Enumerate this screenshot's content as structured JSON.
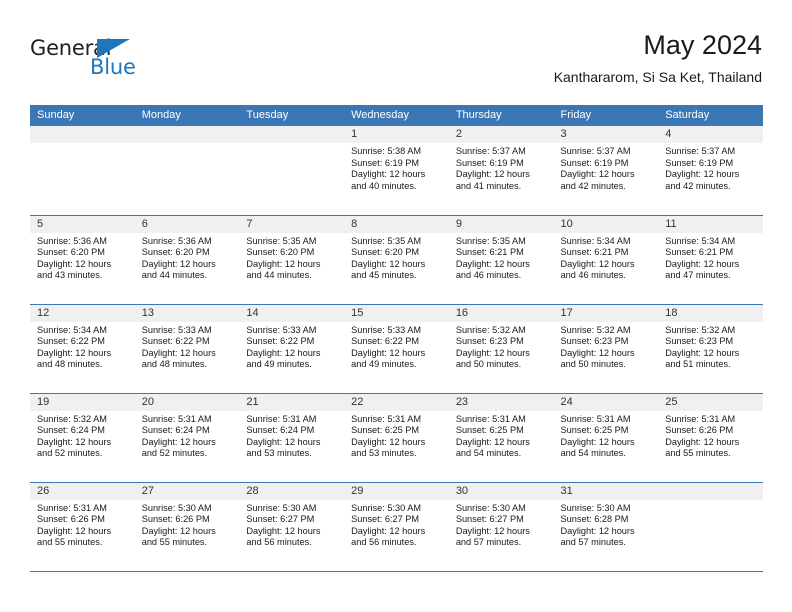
{
  "brand": {
    "name_primary": "General",
    "name_secondary": "Blue"
  },
  "header": {
    "title": "May 2024",
    "subtitle": "Kanthararom, Si Sa Ket, Thailand"
  },
  "colors": {
    "header_blue": "#3b77b5",
    "brand_blue": "#1f76bc",
    "daynum_band": "#f0f0f0"
  },
  "calendar": {
    "day_names": [
      "Sunday",
      "Monday",
      "Tuesday",
      "Wednesday",
      "Thursday",
      "Friday",
      "Saturday"
    ],
    "weeks": [
      [
        {
          "day": "",
          "empty": true
        },
        {
          "day": "",
          "empty": true
        },
        {
          "day": "",
          "empty": true
        },
        {
          "day": "1",
          "sunrise": "Sunrise: 5:38 AM",
          "sunset": "Sunset: 6:19 PM",
          "daylight_1": "Daylight: 12 hours",
          "daylight_2": "and 40 minutes."
        },
        {
          "day": "2",
          "sunrise": "Sunrise: 5:37 AM",
          "sunset": "Sunset: 6:19 PM",
          "daylight_1": "Daylight: 12 hours",
          "daylight_2": "and 41 minutes."
        },
        {
          "day": "3",
          "sunrise": "Sunrise: 5:37 AM",
          "sunset": "Sunset: 6:19 PM",
          "daylight_1": "Daylight: 12 hours",
          "daylight_2": "and 42 minutes."
        },
        {
          "day": "4",
          "sunrise": "Sunrise: 5:37 AM",
          "sunset": "Sunset: 6:19 PM",
          "daylight_1": "Daylight: 12 hours",
          "daylight_2": "and 42 minutes."
        }
      ],
      [
        {
          "day": "5",
          "sunrise": "Sunrise: 5:36 AM",
          "sunset": "Sunset: 6:20 PM",
          "daylight_1": "Daylight: 12 hours",
          "daylight_2": "and 43 minutes."
        },
        {
          "day": "6",
          "sunrise": "Sunrise: 5:36 AM",
          "sunset": "Sunset: 6:20 PM",
          "daylight_1": "Daylight: 12 hours",
          "daylight_2": "and 44 minutes."
        },
        {
          "day": "7",
          "sunrise": "Sunrise: 5:35 AM",
          "sunset": "Sunset: 6:20 PM",
          "daylight_1": "Daylight: 12 hours",
          "daylight_2": "and 44 minutes."
        },
        {
          "day": "8",
          "sunrise": "Sunrise: 5:35 AM",
          "sunset": "Sunset: 6:20 PM",
          "daylight_1": "Daylight: 12 hours",
          "daylight_2": "and 45 minutes."
        },
        {
          "day": "9",
          "sunrise": "Sunrise: 5:35 AM",
          "sunset": "Sunset: 6:21 PM",
          "daylight_1": "Daylight: 12 hours",
          "daylight_2": "and 46 minutes."
        },
        {
          "day": "10",
          "sunrise": "Sunrise: 5:34 AM",
          "sunset": "Sunset: 6:21 PM",
          "daylight_1": "Daylight: 12 hours",
          "daylight_2": "and 46 minutes."
        },
        {
          "day": "11",
          "sunrise": "Sunrise: 5:34 AM",
          "sunset": "Sunset: 6:21 PM",
          "daylight_1": "Daylight: 12 hours",
          "daylight_2": "and 47 minutes."
        }
      ],
      [
        {
          "day": "12",
          "sunrise": "Sunrise: 5:34 AM",
          "sunset": "Sunset: 6:22 PM",
          "daylight_1": "Daylight: 12 hours",
          "daylight_2": "and 48 minutes."
        },
        {
          "day": "13",
          "sunrise": "Sunrise: 5:33 AM",
          "sunset": "Sunset: 6:22 PM",
          "daylight_1": "Daylight: 12 hours",
          "daylight_2": "and 48 minutes."
        },
        {
          "day": "14",
          "sunrise": "Sunrise: 5:33 AM",
          "sunset": "Sunset: 6:22 PM",
          "daylight_1": "Daylight: 12 hours",
          "daylight_2": "and 49 minutes."
        },
        {
          "day": "15",
          "sunrise": "Sunrise: 5:33 AM",
          "sunset": "Sunset: 6:22 PM",
          "daylight_1": "Daylight: 12 hours",
          "daylight_2": "and 49 minutes."
        },
        {
          "day": "16",
          "sunrise": "Sunrise: 5:32 AM",
          "sunset": "Sunset: 6:23 PM",
          "daylight_1": "Daylight: 12 hours",
          "daylight_2": "and 50 minutes."
        },
        {
          "day": "17",
          "sunrise": "Sunrise: 5:32 AM",
          "sunset": "Sunset: 6:23 PM",
          "daylight_1": "Daylight: 12 hours",
          "daylight_2": "and 50 minutes."
        },
        {
          "day": "18",
          "sunrise": "Sunrise: 5:32 AM",
          "sunset": "Sunset: 6:23 PM",
          "daylight_1": "Daylight: 12 hours",
          "daylight_2": "and 51 minutes."
        }
      ],
      [
        {
          "day": "19",
          "sunrise": "Sunrise: 5:32 AM",
          "sunset": "Sunset: 6:24 PM",
          "daylight_1": "Daylight: 12 hours",
          "daylight_2": "and 52 minutes."
        },
        {
          "day": "20",
          "sunrise": "Sunrise: 5:31 AM",
          "sunset": "Sunset: 6:24 PM",
          "daylight_1": "Daylight: 12 hours",
          "daylight_2": "and 52 minutes."
        },
        {
          "day": "21",
          "sunrise": "Sunrise: 5:31 AM",
          "sunset": "Sunset: 6:24 PM",
          "daylight_1": "Daylight: 12 hours",
          "daylight_2": "and 53 minutes."
        },
        {
          "day": "22",
          "sunrise": "Sunrise: 5:31 AM",
          "sunset": "Sunset: 6:25 PM",
          "daylight_1": "Daylight: 12 hours",
          "daylight_2": "and 53 minutes."
        },
        {
          "day": "23",
          "sunrise": "Sunrise: 5:31 AM",
          "sunset": "Sunset: 6:25 PM",
          "daylight_1": "Daylight: 12 hours",
          "daylight_2": "and 54 minutes."
        },
        {
          "day": "24",
          "sunrise": "Sunrise: 5:31 AM",
          "sunset": "Sunset: 6:25 PM",
          "daylight_1": "Daylight: 12 hours",
          "daylight_2": "and 54 minutes."
        },
        {
          "day": "25",
          "sunrise": "Sunrise: 5:31 AM",
          "sunset": "Sunset: 6:26 PM",
          "daylight_1": "Daylight: 12 hours",
          "daylight_2": "and 55 minutes."
        }
      ],
      [
        {
          "day": "26",
          "sunrise": "Sunrise: 5:31 AM",
          "sunset": "Sunset: 6:26 PM",
          "daylight_1": "Daylight: 12 hours",
          "daylight_2": "and 55 minutes."
        },
        {
          "day": "27",
          "sunrise": "Sunrise: 5:30 AM",
          "sunset": "Sunset: 6:26 PM",
          "daylight_1": "Daylight: 12 hours",
          "daylight_2": "and 55 minutes."
        },
        {
          "day": "28",
          "sunrise": "Sunrise: 5:30 AM",
          "sunset": "Sunset: 6:27 PM",
          "daylight_1": "Daylight: 12 hours",
          "daylight_2": "and 56 minutes."
        },
        {
          "day": "29",
          "sunrise": "Sunrise: 5:30 AM",
          "sunset": "Sunset: 6:27 PM",
          "daylight_1": "Daylight: 12 hours",
          "daylight_2": "and 56 minutes."
        },
        {
          "day": "30",
          "sunrise": "Sunrise: 5:30 AM",
          "sunset": "Sunset: 6:27 PM",
          "daylight_1": "Daylight: 12 hours",
          "daylight_2": "and 57 minutes."
        },
        {
          "day": "31",
          "sunrise": "Sunrise: 5:30 AM",
          "sunset": "Sunset: 6:28 PM",
          "daylight_1": "Daylight: 12 hours",
          "daylight_2": "and 57 minutes."
        },
        {
          "day": "",
          "empty": true
        }
      ]
    ]
  }
}
